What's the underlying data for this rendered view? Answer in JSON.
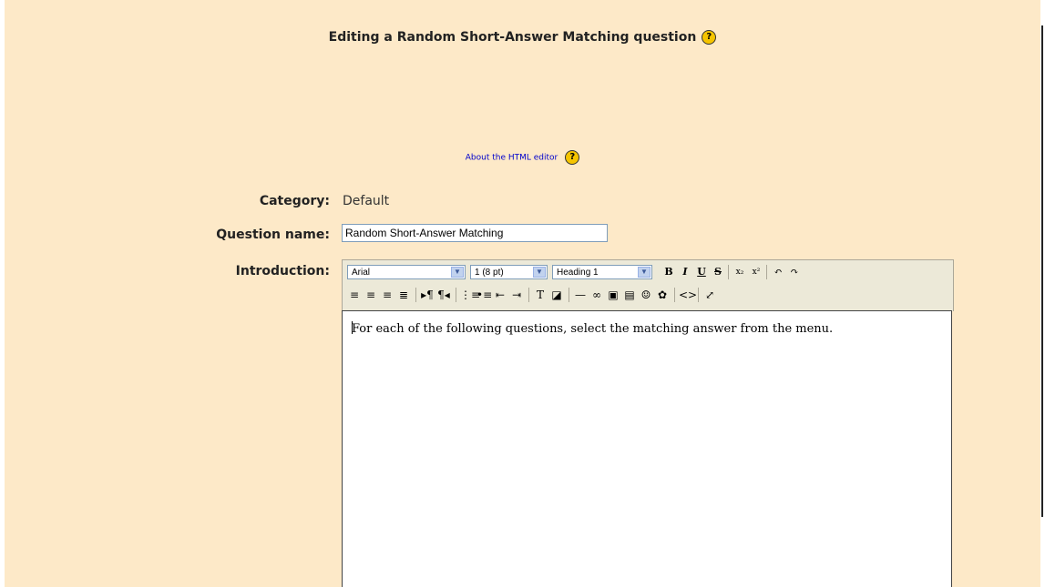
{
  "title": "Editing a Random Short-Answer Matching question",
  "help_glyph": "?",
  "about_link": "About the HTML editor",
  "fields": {
    "category_label": "Category:",
    "category_value": "Default",
    "question_name_label": "Question name:",
    "question_name_value": "Random Short-Answer Matching",
    "introduction_label": "Introduction:"
  },
  "editor": {
    "font_family": "Arial",
    "font_size": "1 (8 pt)",
    "format": "Heading 1",
    "content": "For each of the following questions, select the matching answer from the menu.",
    "buttons_row1": [
      {
        "name": "bold-button",
        "glyph": "B"
      },
      {
        "name": "italic-button",
        "glyph": "I"
      },
      {
        "name": "underline-button",
        "glyph": "U"
      },
      {
        "name": "strikethrough-button",
        "glyph": "S"
      },
      {
        "name": "subscript-button",
        "glyph": "x₂"
      },
      {
        "name": "superscript-button",
        "glyph": "x²"
      },
      {
        "name": "undo-button",
        "glyph": "↶"
      },
      {
        "name": "redo-button",
        "glyph": "↷"
      }
    ],
    "buttons_row2": [
      {
        "name": "align-left-button",
        "glyph": "≡"
      },
      {
        "name": "align-center-button",
        "glyph": "≡"
      },
      {
        "name": "align-right-button",
        "glyph": "≡"
      },
      {
        "name": "justify-button",
        "glyph": "≣"
      },
      {
        "name": "ltr-button",
        "glyph": "▸¶"
      },
      {
        "name": "rtl-button",
        "glyph": "¶◂"
      },
      {
        "name": "ordered-list-button",
        "glyph": "⋮≡"
      },
      {
        "name": "unordered-list-button",
        "glyph": "•≡"
      },
      {
        "name": "outdent-button",
        "glyph": "⇤"
      },
      {
        "name": "indent-button",
        "glyph": "⇥"
      },
      {
        "name": "text-color-button",
        "glyph": "T"
      },
      {
        "name": "background-color-button",
        "glyph": "◪"
      },
      {
        "name": "horizontal-rule-button",
        "glyph": "—"
      },
      {
        "name": "link-button",
        "glyph": "∞"
      },
      {
        "name": "image-button",
        "glyph": "▣"
      },
      {
        "name": "table-button",
        "glyph": "▤"
      },
      {
        "name": "smiley-button",
        "glyph": "☺"
      },
      {
        "name": "special-char-button",
        "glyph": "✿"
      },
      {
        "name": "html-source-button",
        "glyph": "<>"
      },
      {
        "name": "fullscreen-button",
        "glyph": "⤢"
      }
    ]
  }
}
